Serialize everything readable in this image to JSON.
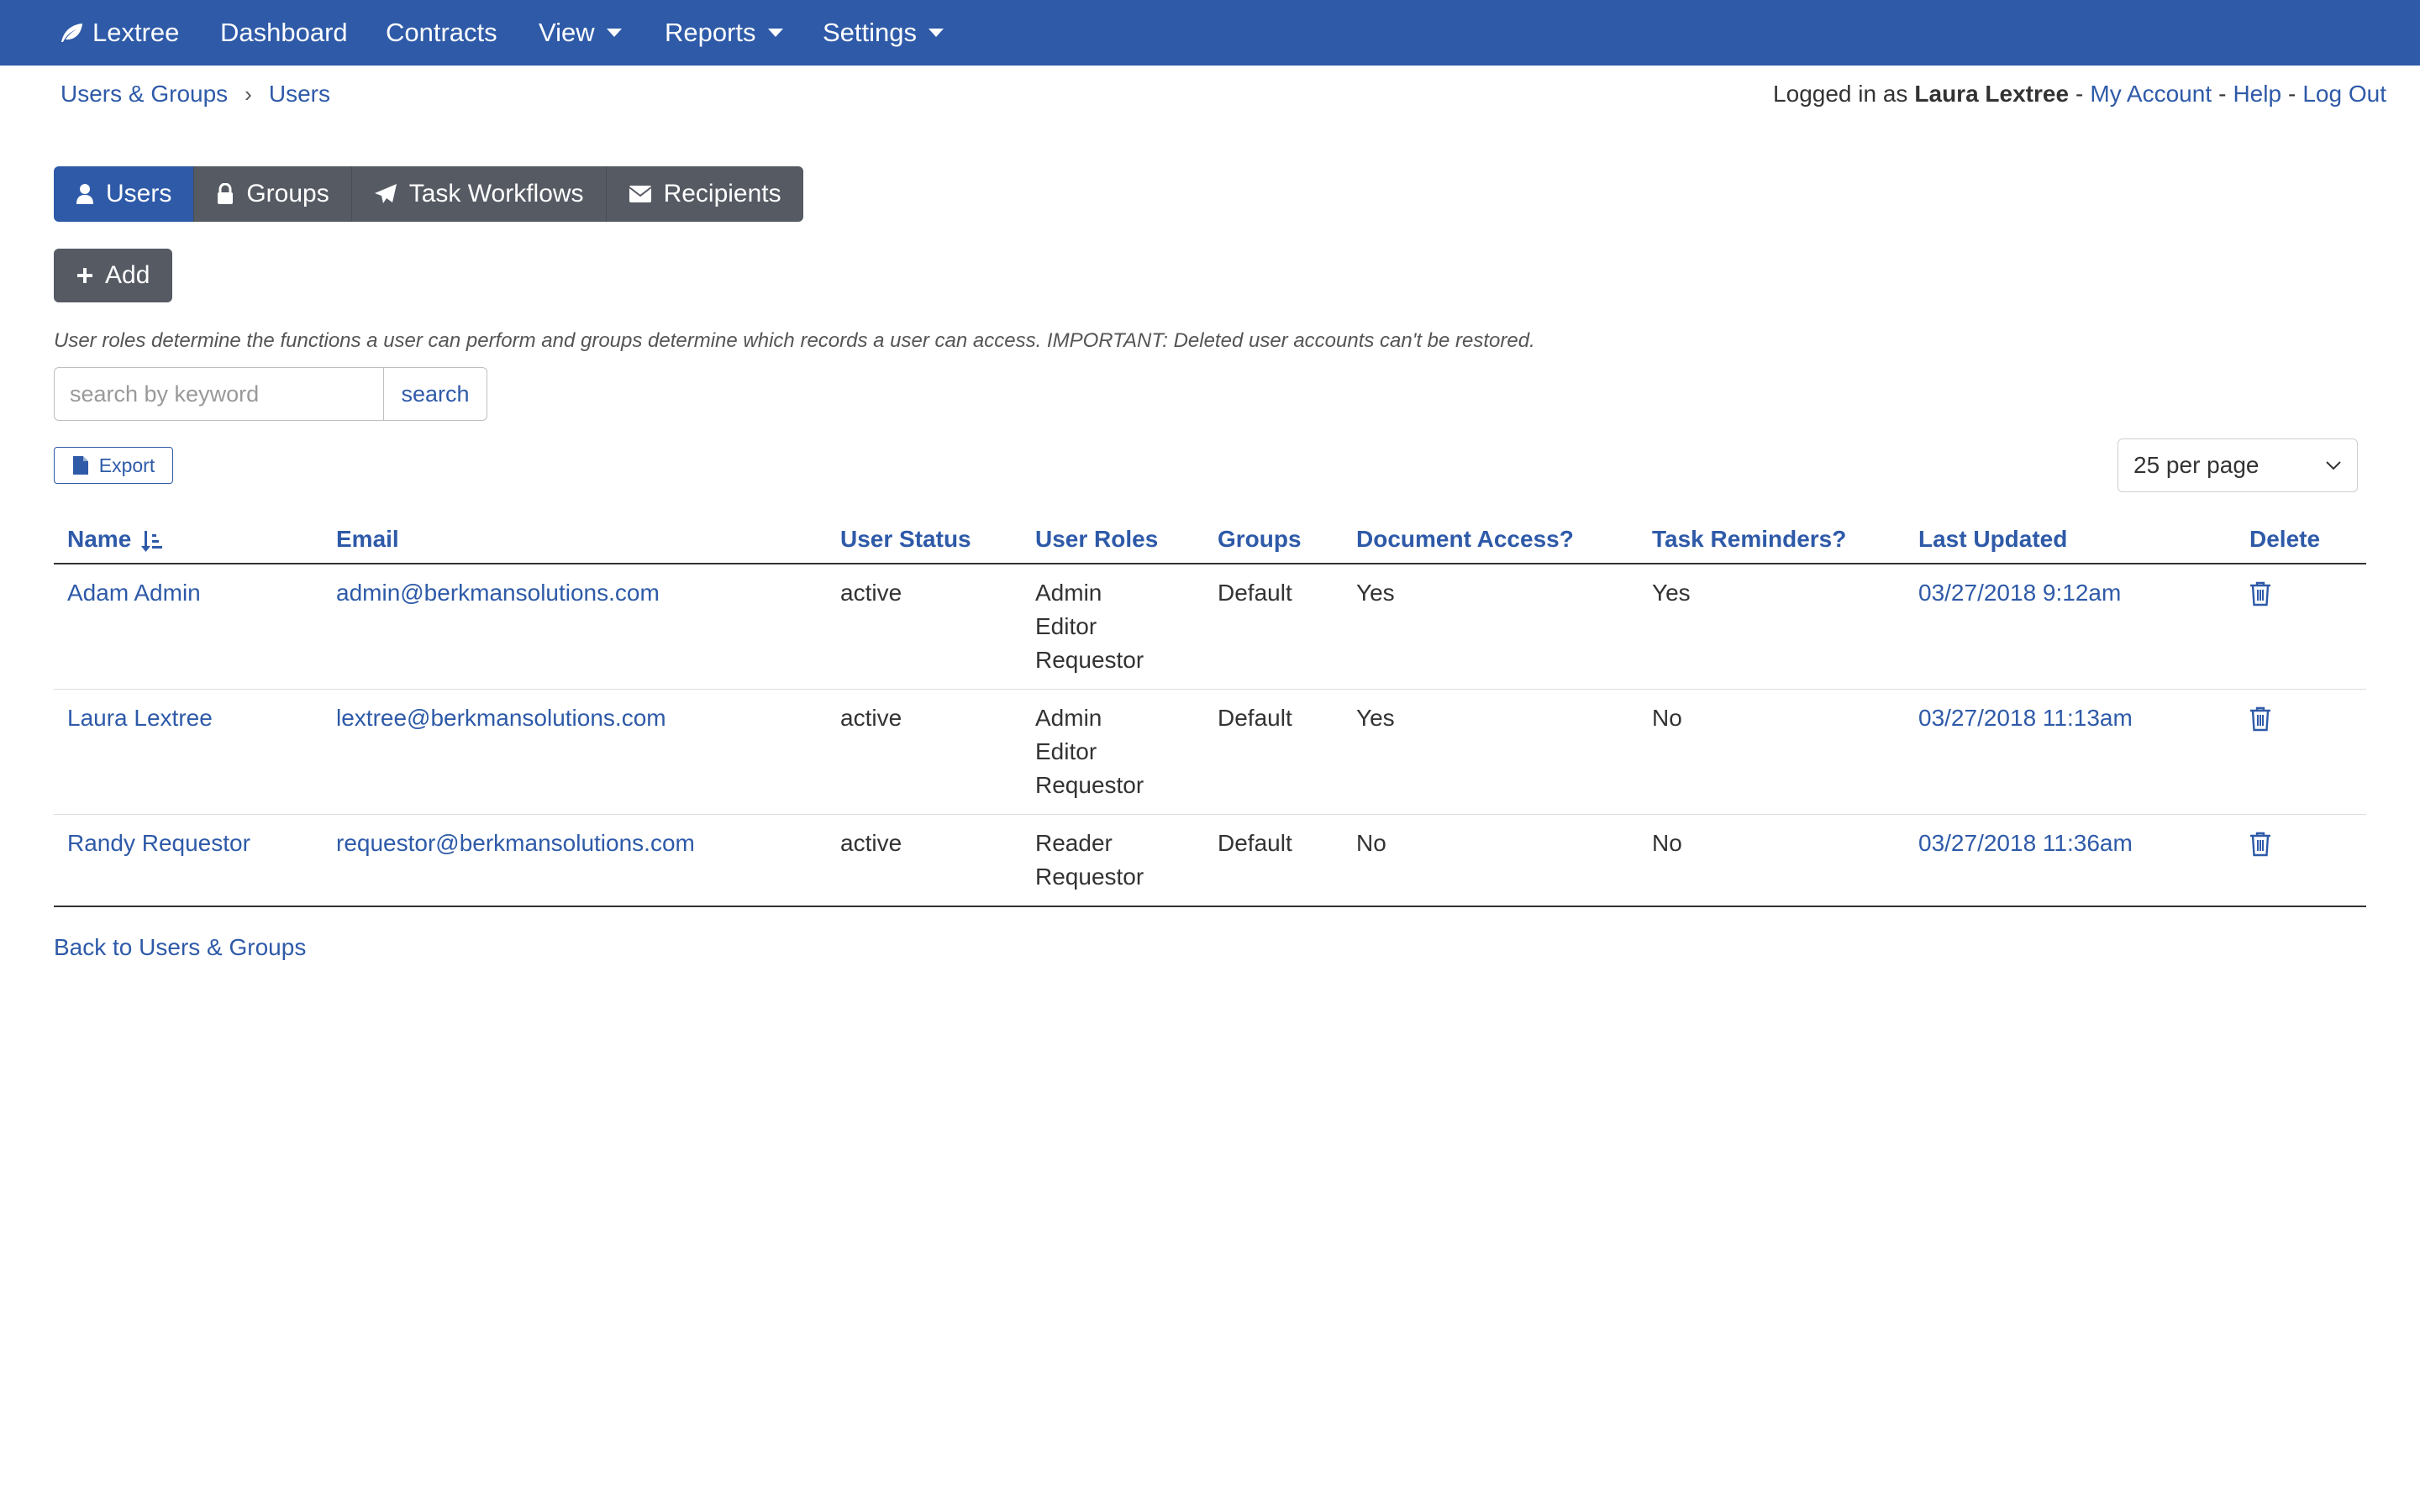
{
  "nav": {
    "brand": "Lextree",
    "items": [
      {
        "label": "Dashboard"
      },
      {
        "label": "Contracts"
      },
      {
        "label": "View"
      },
      {
        "label": "Reports"
      },
      {
        "label": "Settings"
      }
    ]
  },
  "breadcrumb": [
    "Users & Groups",
    "Users"
  ],
  "userline": {
    "prefix": "Logged in as",
    "name": "Laura Lextree",
    "my_account": "My Account",
    "help": "Help",
    "logout": "Log Out",
    "dash": "-"
  },
  "tabs": [
    {
      "label": "Users",
      "icon": "user-icon"
    },
    {
      "label": "Groups",
      "icon": "lock-icon"
    },
    {
      "label": "Task Workflows",
      "icon": "paper-plane-icon"
    },
    {
      "label": "Recipients",
      "icon": "envelope-icon"
    }
  ],
  "add_label": "Add",
  "note": "User roles determine the functions a user can perform and groups determine which records a user can access. IMPORTANT: Deleted user accounts can't be restored.",
  "search": {
    "placeholder": "search by keyword",
    "button": "search"
  },
  "export_label": "Export",
  "per_page": "25 per page",
  "table": {
    "headers": [
      "Name",
      "Email",
      "User Status",
      "User Roles",
      "Groups",
      "Document Access?",
      "Task Reminders?",
      "Last Updated",
      "Delete"
    ],
    "rows": [
      {
        "name": "Adam Admin",
        "email": "admin@berkmansolutions.com",
        "status": "active",
        "roles": [
          "Admin",
          "Editor",
          "Requestor"
        ],
        "groups": "Default",
        "doc_access": "Yes",
        "reminders": "Yes",
        "updated": "03/27/2018 9:12am"
      },
      {
        "name": "Laura Lextree",
        "email": "lextree@berkmansolutions.com",
        "status": "active",
        "roles": [
          "Admin",
          "Editor",
          "Requestor"
        ],
        "groups": "Default",
        "doc_access": "Yes",
        "reminders": "No",
        "updated": "03/27/2018 11:13am"
      },
      {
        "name": "Randy Requestor",
        "email": "requestor@berkmansolutions.com",
        "status": "active",
        "roles": [
          "Reader",
          "Requestor"
        ],
        "groups": "Default",
        "doc_access": "No",
        "reminders": "No",
        "updated": "03/27/2018 11:36am"
      }
    ]
  },
  "back_link": "Back to Users & Groups",
  "colors": {
    "primary": "#2e5aa8",
    "tab_inactive": "#555a63",
    "text": "#333333"
  }
}
